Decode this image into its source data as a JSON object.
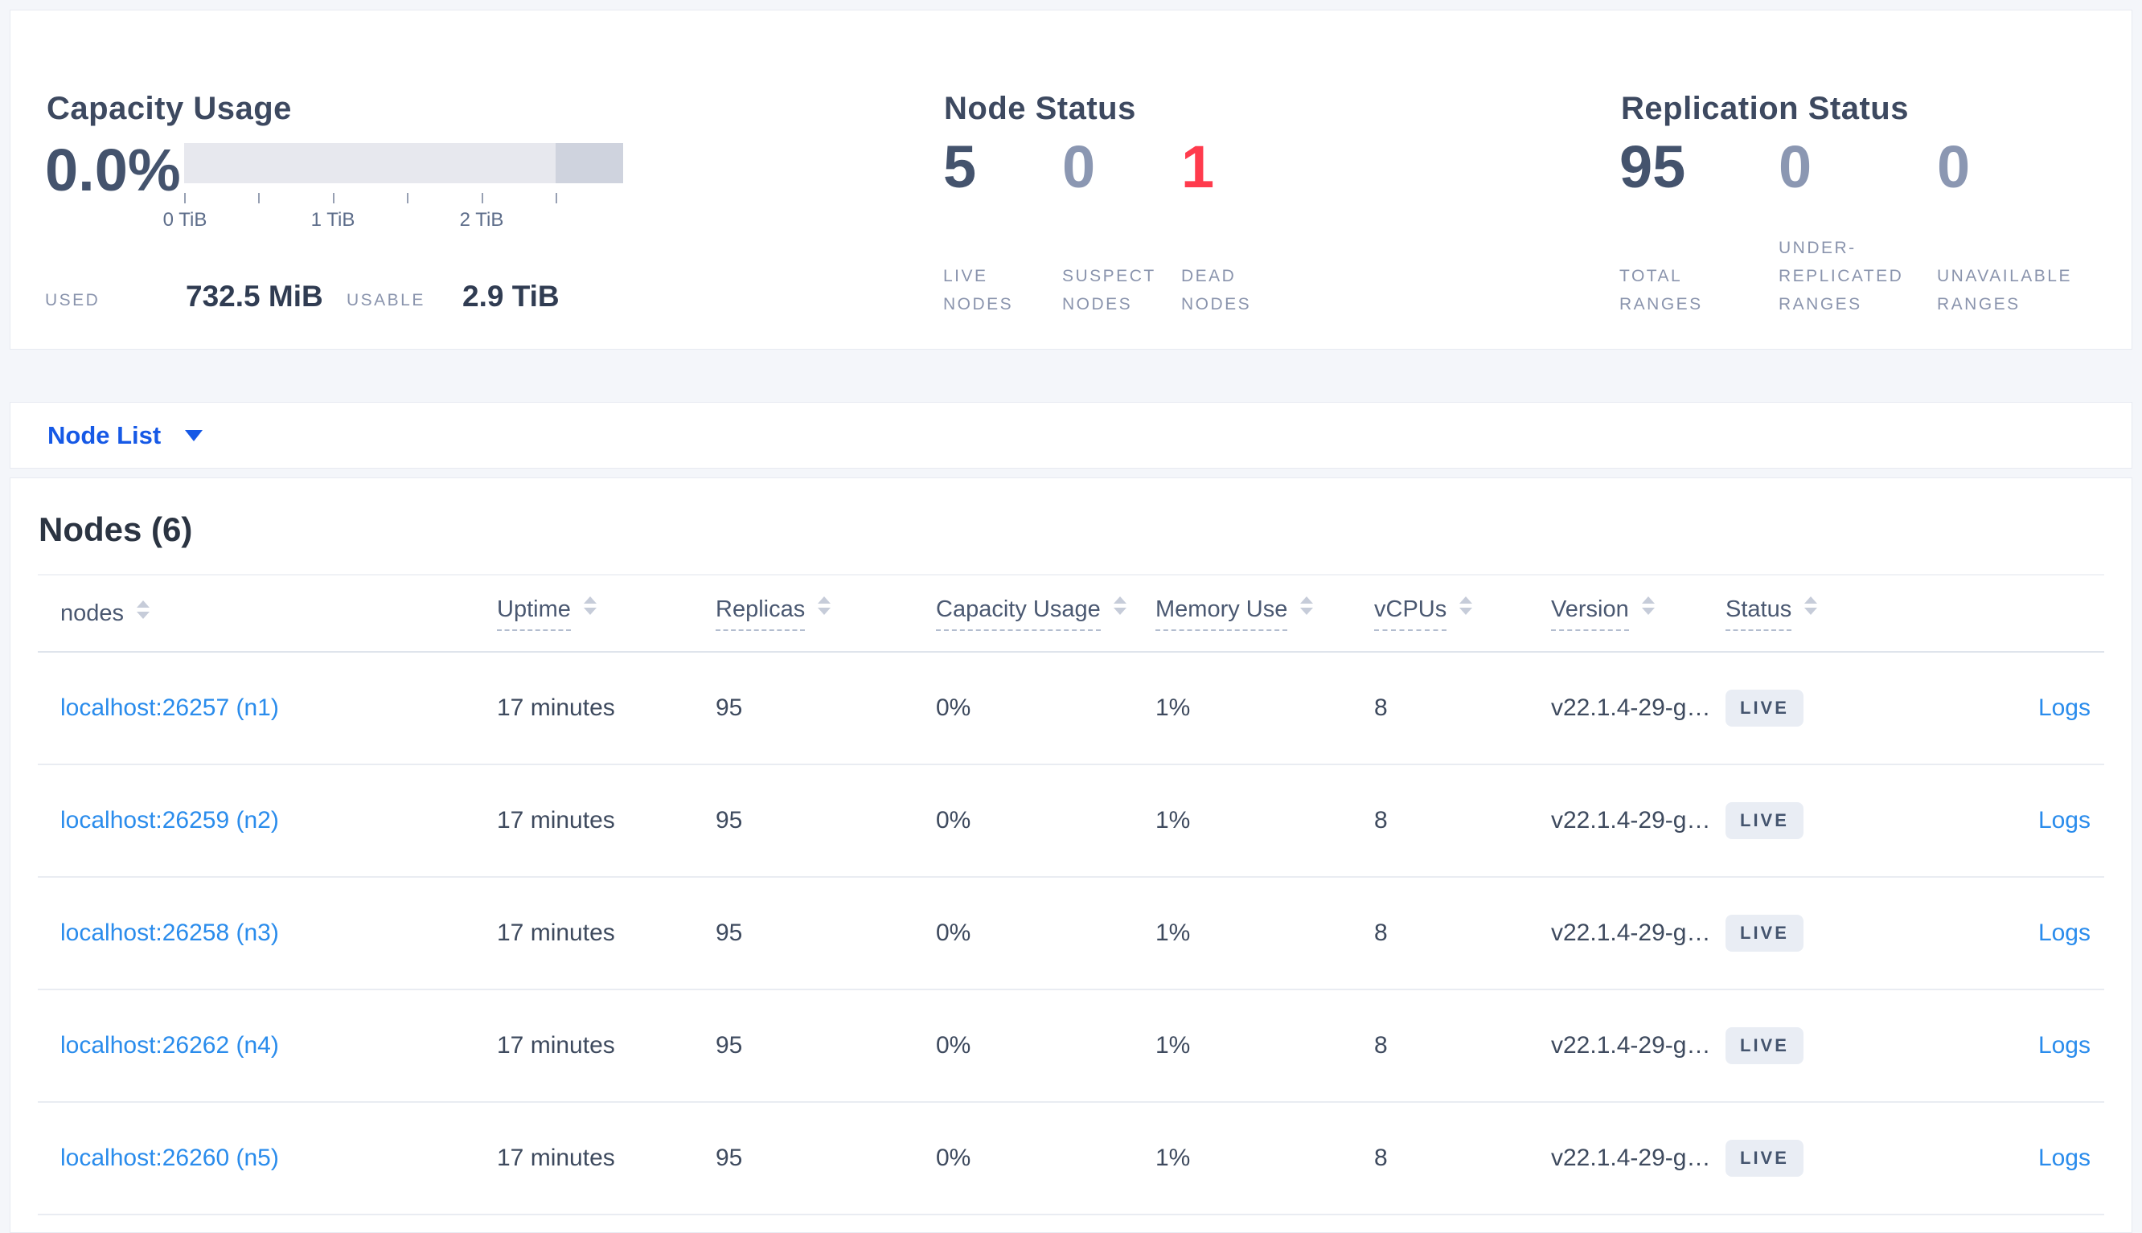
{
  "summary": {
    "capacity": {
      "title": "Capacity Usage",
      "percent": "0.0%",
      "tick_labels": [
        "0 TiB",
        "1 TiB",
        "2 TiB"
      ],
      "used_label": "USED",
      "used_value": "732.5 MiB",
      "usable_label": "USABLE",
      "usable_value": "2.9 TiB"
    },
    "node_status": {
      "title": "Node Status",
      "metrics": [
        {
          "value": "5",
          "label": "LIVE NODES"
        },
        {
          "value": "0",
          "label": "SUSPECT NODES"
        },
        {
          "value": "1",
          "label": "DEAD NODES"
        }
      ]
    },
    "replication": {
      "title": "Replication Status",
      "metrics": [
        {
          "value": "95",
          "label": "TOTAL RANGES"
        },
        {
          "value": "0",
          "label": "UNDER-REPLICATED RANGES"
        },
        {
          "value": "0",
          "label": "UNAVAILABLE RANGES"
        }
      ]
    }
  },
  "view_selector": {
    "label": "Node List"
  },
  "table": {
    "title": "Nodes (6)",
    "columns": [
      {
        "label": "nodes"
      },
      {
        "label": "Uptime"
      },
      {
        "label": "Replicas"
      },
      {
        "label": "Capacity Usage"
      },
      {
        "label": "Memory Use"
      },
      {
        "label": "vCPUs"
      },
      {
        "label": "Version"
      },
      {
        "label": "Status"
      }
    ],
    "rows": [
      {
        "node": "localhost:26257 (n1)",
        "uptime": "17 minutes",
        "replicas": "95",
        "capacity": "0%",
        "memory": "1%",
        "vcpus": "8",
        "version": "v22.1.4-29-g…",
        "status": "LIVE",
        "logs": "Logs"
      },
      {
        "node": "localhost:26259 (n2)",
        "uptime": "17 minutes",
        "replicas": "95",
        "capacity": "0%",
        "memory": "1%",
        "vcpus": "8",
        "version": "v22.1.4-29-g…",
        "status": "LIVE",
        "logs": "Logs"
      },
      {
        "node": "localhost:26258 (n3)",
        "uptime": "17 minutes",
        "replicas": "95",
        "capacity": "0%",
        "memory": "1%",
        "vcpus": "8",
        "version": "v22.1.4-29-g…",
        "status": "LIVE",
        "logs": "Logs"
      },
      {
        "node": "localhost:26262 (n4)",
        "uptime": "17 minutes",
        "replicas": "95",
        "capacity": "0%",
        "memory": "1%",
        "vcpus": "8",
        "version": "v22.1.4-29-g…",
        "status": "LIVE",
        "logs": "Logs"
      },
      {
        "node": "localhost:26260 (n5)",
        "uptime": "17 minutes",
        "replicas": "95",
        "capacity": "0%",
        "memory": "1%",
        "vcpus": "8",
        "version": "v22.1.4-29-g…",
        "status": "LIVE",
        "logs": "Logs"
      }
    ]
  },
  "colors": {
    "page_background": "#f4f6fa",
    "card_background": "#ffffff",
    "primary_number": "#44536d",
    "muted_number": "#8b97b2",
    "danger_number": "#ff3b4d",
    "caps_label": "#8a94ad",
    "link_blue": "#2a8cec",
    "selector_blue": "#1659e6",
    "badge_background": "#e9edf4",
    "badge_text": "#44546e",
    "bar_light": "#e7e8ee",
    "bar_dark": "#cfd3de"
  }
}
